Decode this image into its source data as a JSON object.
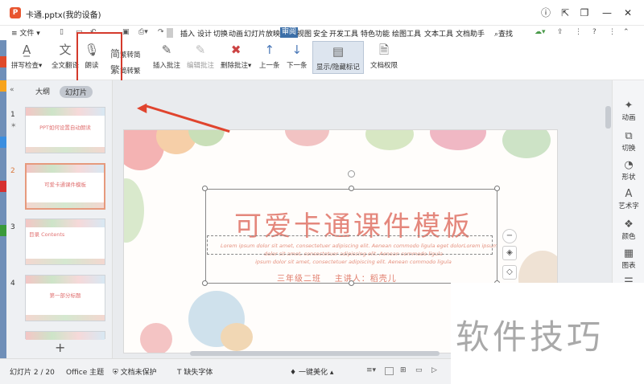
{
  "window": {
    "title": "卡通.pptx(我的设备)"
  },
  "menubar": {
    "file": "文件",
    "tabs": [
      "插入",
      "设计",
      "切换",
      "动画",
      "幻灯片放映",
      "审阅",
      "视图",
      "安全",
      "开发工具",
      "特色功能",
      "绘图工具",
      "文本工具",
      "文档助手"
    ],
    "active_tab": "审阅",
    "search": "查找"
  },
  "ribbon": {
    "spellcheck": "拼写检查",
    "translate": "全文翻译",
    "read_aloud": "朗读",
    "to_simplified": "繁转简",
    "simplified_char": "简",
    "to_traditional": "简转繁",
    "traditional_char": "繁",
    "insert_comment": "插入批注",
    "edit_comment": "编辑批注",
    "delete_comment": "删除批注",
    "prev": "上一条",
    "next": "下一条",
    "show_hide": "显示/隐藏标记",
    "permission": "文档权限"
  },
  "panel": {
    "tab_outline": "大纲",
    "tab_slides": "幻灯片",
    "thumbs": [
      {
        "num": "1",
        "title": "PPT如何设置自动朗读"
      },
      {
        "num": "2",
        "title": "可爱卡通课件模板"
      },
      {
        "num": "3",
        "title": "目录 Contents"
      },
      {
        "num": "4",
        "title": "第一部分标题"
      }
    ],
    "add": "+"
  },
  "slide": {
    "title": "可爱卡通课件模板",
    "lorem1": "Lorem ipsum dolor sit amet, consectetuer adipiscing elit. Aenean commodo ligula eget dolorLorem ipsum",
    "lorem2": "dolor sit amet, consectetuer adipiscing elit. Aenean commodo ligula",
    "lorem3": "ipsum dolor sit amet, consectetuer adipiscing elit. Aenean commodo ligula",
    "grade": "三年级二班",
    "speaker": "主讲人：稻壳儿"
  },
  "rightpanel": [
    "动画",
    "切换",
    "形状",
    "艺术字",
    "颜色",
    "图表"
  ],
  "status": {
    "slide": "幻灯片 2 / 20",
    "theme": "Office 主题",
    "protect": "文档未保护",
    "missing_font": "缺失字体",
    "beautify": "一键美化"
  },
  "watermark": "软件技巧"
}
